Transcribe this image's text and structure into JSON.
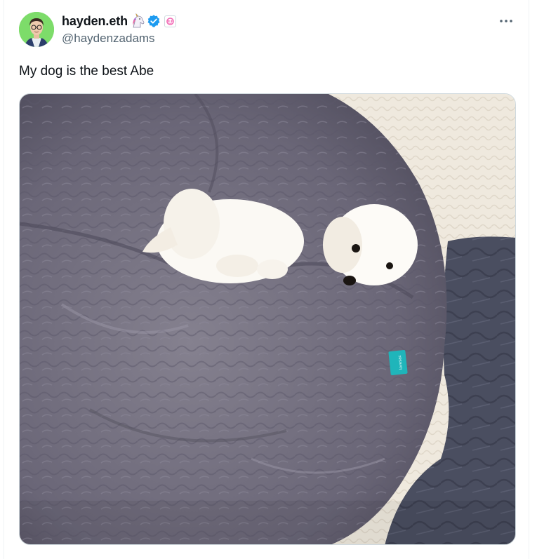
{
  "tweet": {
    "author": {
      "display_name": "hayden.eth",
      "handle": "@haydenzadams",
      "avatar_icon": "avatar-photo",
      "badges": [
        "unicorn-icon",
        "verified-icon",
        "affiliate-badge"
      ]
    },
    "text": "My dog is the best Abe",
    "more_icon": "more-icon",
    "media": {
      "type": "photo",
      "alt": "",
      "tag_text": "lovesac"
    }
  },
  "colors": {
    "verified": "#1d9bf0",
    "text_primary": "#0f1419",
    "text_secondary": "#536471",
    "avatar_bg": "#7ddc6a",
    "beanbag": "#6d6a7a",
    "rug": "#efe9de",
    "blanket": "#4a4e60",
    "tag": "#1fb5ba"
  }
}
